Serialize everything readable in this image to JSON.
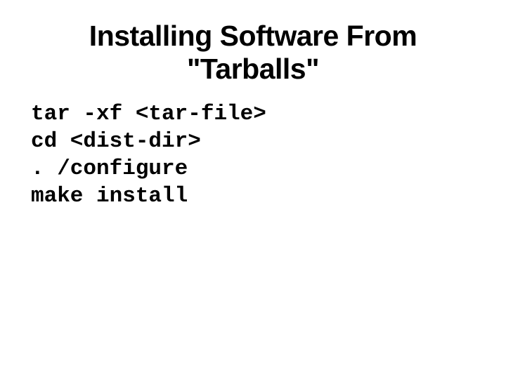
{
  "slide": {
    "title": "Installing Software From \"Tarballs\"",
    "code": {
      "line1": "tar -xf <tar-file>",
      "line2": "cd <dist-dir>",
      "line3": ". /configure",
      "line4": "make install"
    }
  }
}
